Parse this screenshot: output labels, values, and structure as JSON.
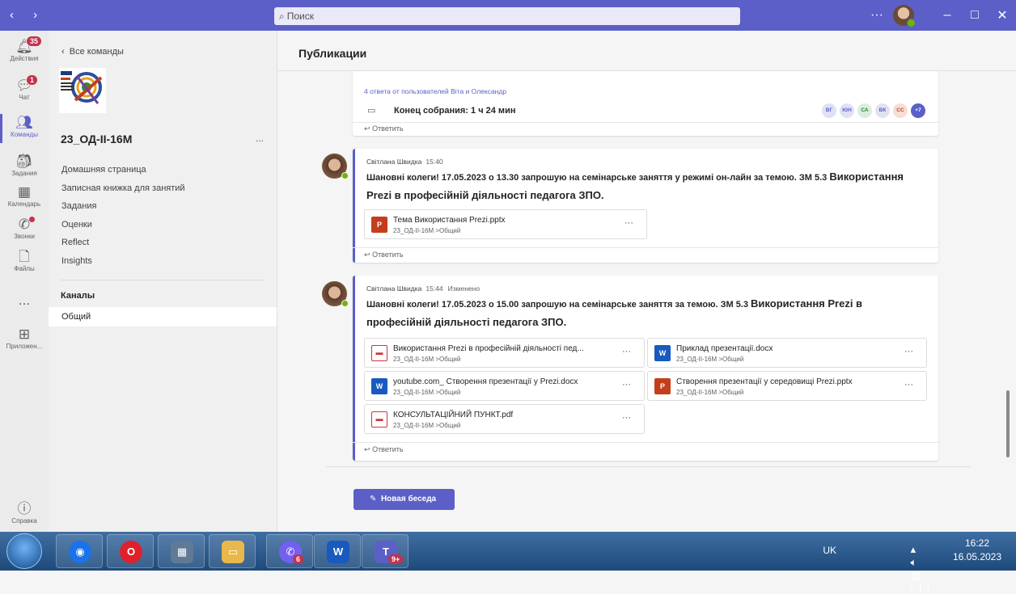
{
  "search": {
    "placeholder": "Поиск"
  },
  "rail": {
    "activity": {
      "label": "Действия",
      "badge": "35"
    },
    "chat": {
      "label": "Чат",
      "badge": "1"
    },
    "teams": {
      "label": "Команды"
    },
    "assignments": {
      "label": "Задания"
    },
    "calendar": {
      "label": "Календарь"
    },
    "calls": {
      "label": "Звонки"
    },
    "files": {
      "label": "Файлы"
    },
    "more": {
      "label": "..."
    },
    "apps": {
      "label": "Приложен..."
    },
    "help": {
      "label": "Справка"
    }
  },
  "sidebar": {
    "back_label": "Все команды",
    "team_name": "23_ОД-ІІ-16М",
    "more": "...",
    "nav": [
      "Домашняя страница",
      "Записная книжка для занятий",
      "Задания",
      "Оценки",
      "Reflect",
      "Insights"
    ],
    "channels_header": "Каналы",
    "selected_channel": "Общий"
  },
  "main": {
    "title": "Публикации",
    "post0": {
      "replies": "4 ответа от пользователей Віта и Олександр",
      "meeting_end": "Конец собрания: 1 ч 24 мин",
      "participants": [
        "ВГ",
        "ЮН",
        "СА",
        "ВК",
        "СС"
      ],
      "participants_more": "+7",
      "reply": "Ответить"
    },
    "post1": {
      "author": "Світлана Швидка",
      "time": "15:40",
      "text_a": "Шановні колеги! 17.05.2023 о 13.30 запрошую на семінарське заняття у режимі он-лайн за темою. ЗМ 5.3 ",
      "text_big_1": "Використання",
      "text_big_2": "Prezi в професійній діяльності педагога ЗПО.",
      "attachment": {
        "name": "Тема Використання Prezi.pptx",
        "path": "23_ОД-ІІ-16М >Общий"
      },
      "reply": "Ответить"
    },
    "post2": {
      "author": "Світлана Швидка",
      "time": "15:44",
      "edited": "Изменено",
      "text_a": "Шановні колеги! 17.05.2023 о 15.00 запрошую на семінарське заняття  за темою. ЗМ 5.3 ",
      "text_big_1": "Використання Prezi в",
      "text_big_2": "професійній діяльності педагога ЗПО.",
      "attachments": [
        {
          "name": "Використання Prezi в професійній діяльності пед...",
          "path": "23_ОД-ІІ-16М >Общий"
        },
        {
          "name": "Приклад презентації.docx",
          "path": "23_ОД-ІІ-16М >Общий"
        },
        {
          "name": "youtube.com_ Створення презентації у Prezi.docx",
          "path": "23_ОД-ІІ-16М >Общий"
        },
        {
          "name": "Створення презентації у середовищі Prezi.pptx",
          "path": "23_ОД-ІІ-16М >Общий"
        },
        {
          "name": "КОНСУЛЬТАЦІЙНИЙ ПУНКТ.pdf",
          "path": "23_ОД-ІІ-16М >Общий"
        }
      ],
      "reply": "Ответить"
    },
    "new_conversation": "Новая беседа"
  },
  "taskbar": {
    "viber_badge": "6",
    "teams_badge": "9+",
    "language": "UK",
    "time": "16:22",
    "date": "16.05.2023"
  },
  "colors": {
    "accent": "#5b5fc7",
    "badge": "#c4314b",
    "status_online": "#6bb700"
  }
}
